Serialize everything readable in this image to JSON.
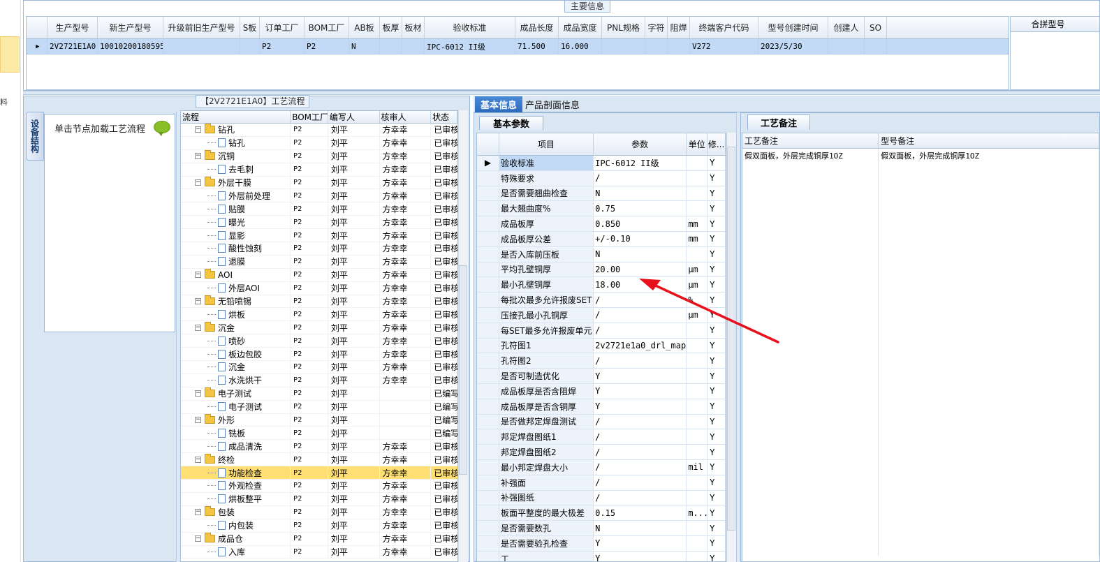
{
  "left_strip": {
    "char": "料"
  },
  "main_info": {
    "title": "主要信息",
    "columns": [
      "生产型号",
      "新生产型号",
      "升级前旧生产型号",
      "S板",
      "订单工厂",
      "BOM工厂",
      "AB板",
      "板厚",
      "板材",
      "验收标准",
      "成品长度",
      "成品宽度",
      "PNL规格",
      "字符",
      "阻焊",
      "终端客户代码",
      "型号创建时间",
      "创建人",
      "SO"
    ],
    "row": [
      "2V2721E1A0",
      "10010200180595",
      "",
      "",
      "P2",
      "P2",
      "N",
      "",
      "",
      "IPC-6012 II级",
      "71.500",
      "16.000",
      "",
      "",
      "",
      "V272",
      "2023/5/30",
      "",
      ""
    ],
    "merge_header": "合拼型号"
  },
  "process": {
    "title": "【2V2721E1A0】工艺流程",
    "vtab_label": "设备结构",
    "hint": "单击节点加载工艺流程",
    "columns": [
      "流程",
      "BOM工厂",
      "编写人",
      "核审人",
      "状态"
    ],
    "rows": [
      {
        "type": "group",
        "name": "钻孔",
        "bom": "P2",
        "writer": "刘平",
        "reviewer": "方幸幸",
        "status": "已审核"
      },
      {
        "type": "leaf",
        "name": "钻孔",
        "bom": "P2",
        "writer": "刘平",
        "reviewer": "方幸幸",
        "status": "已审核"
      },
      {
        "type": "group",
        "name": "沉铜",
        "bom": "P2",
        "writer": "刘平",
        "reviewer": "方幸幸",
        "status": "已审核"
      },
      {
        "type": "leaf",
        "name": "去毛刺",
        "bom": "P2",
        "writer": "刘平",
        "reviewer": "方幸幸",
        "status": "已审核"
      },
      {
        "type": "group",
        "name": "外层干膜",
        "bom": "P2",
        "writer": "刘平",
        "reviewer": "方幸幸",
        "status": "已审核"
      },
      {
        "type": "leaf",
        "name": "外层前处理",
        "bom": "P2",
        "writer": "刘平",
        "reviewer": "方幸幸",
        "status": "已审核"
      },
      {
        "type": "leaf",
        "name": "贴膜",
        "bom": "P2",
        "writer": "刘平",
        "reviewer": "方幸幸",
        "status": "已审核"
      },
      {
        "type": "leaf",
        "name": "曝光",
        "bom": "P2",
        "writer": "刘平",
        "reviewer": "方幸幸",
        "status": "已审核"
      },
      {
        "type": "leaf",
        "name": "显影",
        "bom": "P2",
        "writer": "刘平",
        "reviewer": "方幸幸",
        "status": "已审核"
      },
      {
        "type": "leaf",
        "name": "酸性蚀刻",
        "bom": "P2",
        "writer": "刘平",
        "reviewer": "方幸幸",
        "status": "已审核"
      },
      {
        "type": "leaf",
        "name": "退膜",
        "bom": "P2",
        "writer": "刘平",
        "reviewer": "方幸幸",
        "status": "已审核"
      },
      {
        "type": "group",
        "name": "AOI",
        "bom": "P2",
        "writer": "刘平",
        "reviewer": "方幸幸",
        "status": "已审核"
      },
      {
        "type": "leaf",
        "name": "外层AOI",
        "bom": "P2",
        "writer": "刘平",
        "reviewer": "方幸幸",
        "status": "已审核"
      },
      {
        "type": "group",
        "name": "无铅喷锡",
        "bom": "P2",
        "writer": "刘平",
        "reviewer": "方幸幸",
        "status": "已审核"
      },
      {
        "type": "leaf",
        "name": "烘板",
        "bom": "P2",
        "writer": "刘平",
        "reviewer": "方幸幸",
        "status": "已审核"
      },
      {
        "type": "group",
        "name": "沉金",
        "bom": "P2",
        "writer": "刘平",
        "reviewer": "方幸幸",
        "status": "已审核"
      },
      {
        "type": "leaf",
        "name": "喷砂",
        "bom": "P2",
        "writer": "刘平",
        "reviewer": "方幸幸",
        "status": "已审核"
      },
      {
        "type": "leaf",
        "name": "板边包胶",
        "bom": "P2",
        "writer": "刘平",
        "reviewer": "方幸幸",
        "status": "已审核"
      },
      {
        "type": "leaf",
        "name": "沉金",
        "bom": "P2",
        "writer": "刘平",
        "reviewer": "方幸幸",
        "status": "已审核"
      },
      {
        "type": "leaf",
        "name": "水洗烘干",
        "bom": "P2",
        "writer": "刘平",
        "reviewer": "方幸幸",
        "status": "已审核"
      },
      {
        "type": "group",
        "name": "电子测试",
        "bom": "P2",
        "writer": "刘平",
        "reviewer": "",
        "status": "已编写"
      },
      {
        "type": "leaf",
        "name": "电子测试",
        "bom": "P2",
        "writer": "刘平",
        "reviewer": "",
        "status": "已编写"
      },
      {
        "type": "group",
        "name": "外形",
        "bom": "P2",
        "writer": "刘平",
        "reviewer": "",
        "status": "已编写"
      },
      {
        "type": "leaf",
        "name": "铣板",
        "bom": "P2",
        "writer": "刘平",
        "reviewer": "",
        "status": "已编写"
      },
      {
        "type": "leaf",
        "name": "成品清洗",
        "bom": "P2",
        "writer": "刘平",
        "reviewer": "方幸幸",
        "status": "已审核"
      },
      {
        "type": "group",
        "name": "终检",
        "bom": "P2",
        "writer": "刘平",
        "reviewer": "方幸幸",
        "status": "已审核"
      },
      {
        "type": "leaf",
        "name": "功能检查",
        "bom": "P2",
        "writer": "刘平",
        "reviewer": "方幸幸",
        "status": "已审核",
        "selected": true
      },
      {
        "type": "leaf",
        "name": "外观检查",
        "bom": "P2",
        "writer": "刘平",
        "reviewer": "方幸幸",
        "status": "已审核"
      },
      {
        "type": "leaf",
        "name": "烘板整平",
        "bom": "P2",
        "writer": "刘平",
        "reviewer": "方幸幸",
        "status": "已审核"
      },
      {
        "type": "group",
        "name": "包装",
        "bom": "P2",
        "writer": "刘平",
        "reviewer": "方幸幸",
        "status": "已审核"
      },
      {
        "type": "leaf",
        "name": "内包装",
        "bom": "P2",
        "writer": "刘平",
        "reviewer": "方幸幸",
        "status": "已审核"
      },
      {
        "type": "group",
        "name": "成品仓",
        "bom": "P2",
        "writer": "刘平",
        "reviewer": "方幸幸",
        "status": "已审核"
      },
      {
        "type": "leaf",
        "name": "入库",
        "bom": "P2",
        "writer": "刘平",
        "reviewer": "方幸幸",
        "status": "已审核"
      }
    ]
  },
  "tabs": {
    "basic": "基本信息",
    "profile": "产品剖面信息",
    "sub": "基本参数"
  },
  "params": {
    "columns": [
      "项目",
      "参数",
      "单位",
      "修..."
    ],
    "rows": [
      {
        "item": "验收标准",
        "value": "IPC-6012 II级",
        "unit": "",
        "mod": "Y",
        "current": true
      },
      {
        "item": "特殊要求",
        "value": "/",
        "unit": "",
        "mod": "Y"
      },
      {
        "item": "是否需要翘曲检查",
        "value": "N",
        "unit": "",
        "mod": "Y"
      },
      {
        "item": "最大翘曲度%",
        "value": "0.75",
        "unit": "",
        "mod": "Y"
      },
      {
        "item": "成品板厚",
        "value": "0.850",
        "unit": "mm",
        "mod": "Y"
      },
      {
        "item": "成品板厚公差",
        "value": "+/-0.10",
        "unit": "mm",
        "mod": "Y"
      },
      {
        "item": "是否入库前压板",
        "value": "N",
        "unit": "",
        "mod": "Y"
      },
      {
        "item": "平均孔壁铜厚",
        "value": "20.00",
        "unit": "μm",
        "mod": "Y"
      },
      {
        "item": "最小孔壁铜厚",
        "value": "18.00",
        "unit": "μm",
        "mod": "Y"
      },
      {
        "item": "每批次最多允许报废SET",
        "value": "/",
        "unit": "%",
        "mod": "Y"
      },
      {
        "item": "压接孔最小孔铜厚",
        "value": "/",
        "unit": "μm",
        "mod": "Y"
      },
      {
        "item": "每SET最多允许报废单元",
        "value": "/",
        "unit": "",
        "mod": "Y"
      },
      {
        "item": "孔符图1",
        "value": "2v2721e1a0_drl_map...",
        "unit": "",
        "mod": "Y"
      },
      {
        "item": "孔符图2",
        "value": "/",
        "unit": "",
        "mod": "Y"
      },
      {
        "item": "是否可制造优化",
        "value": "Y",
        "unit": "",
        "mod": "Y"
      },
      {
        "item": "成品板厚是否含阻焊",
        "value": "Y",
        "unit": "",
        "mod": "Y"
      },
      {
        "item": "成品板厚是否含铜厚",
        "value": "Y",
        "unit": "",
        "mod": "Y"
      },
      {
        "item": "是否做邦定焊盘测试",
        "value": "/",
        "unit": "",
        "mod": "Y"
      },
      {
        "item": "邦定焊盘图纸1",
        "value": "/",
        "unit": "",
        "mod": "Y"
      },
      {
        "item": "邦定焊盘图纸2",
        "value": "/",
        "unit": "",
        "mod": "Y"
      },
      {
        "item": "最小邦定焊盘大小",
        "value": "/",
        "unit": "mil",
        "mod": "Y"
      },
      {
        "item": "补强面",
        "value": "/",
        "unit": "",
        "mod": "Y"
      },
      {
        "item": "补强图纸",
        "value": "/",
        "unit": "",
        "mod": "Y"
      },
      {
        "item": "板面平整度的最大极差",
        "value": "0.15",
        "unit": "m...",
        "mod": "Y"
      },
      {
        "item": "是否需要数孔",
        "value": "N",
        "unit": "",
        "mod": "Y"
      },
      {
        "item": "是否需要验孔检查",
        "value": "Y",
        "unit": "",
        "mod": "Y"
      },
      {
        "item": "工",
        "value": "Y",
        "unit": "",
        "mod": "Y"
      }
    ]
  },
  "remarks": {
    "tab": "工艺备注",
    "columns": [
      "工艺备注",
      "型号备注"
    ],
    "process_note": "假双面板，外层完成铜厚1OZ",
    "model_note": "假双面板，外层完成铜厚1OZ"
  },
  "colors": {
    "annotation_arrow": "#e8101a",
    "selection": "#ffdf74",
    "row_highlight": "#c2daf5"
  }
}
